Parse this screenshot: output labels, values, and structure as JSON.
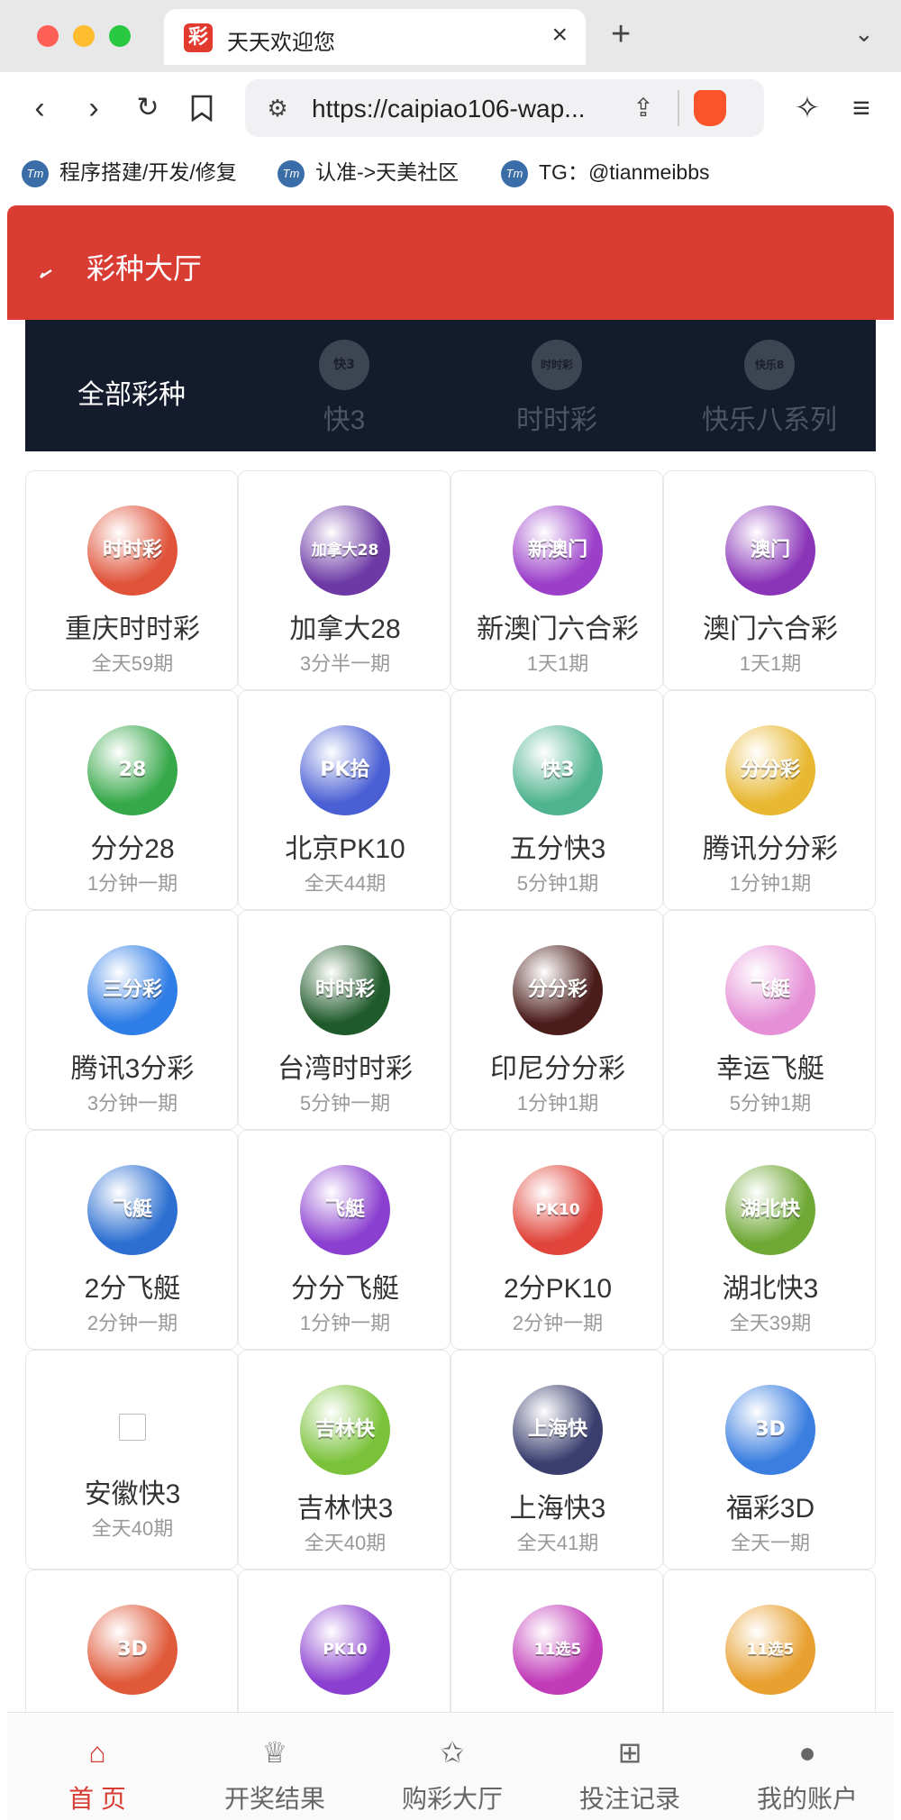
{
  "browser": {
    "tab_title": "天天欢迎您",
    "tab_favicon": "彩",
    "url": "https://caipiao106-wap...",
    "bookmarks": [
      "程序搭建/开发/修复",
      "认准->天美社区",
      "TG：@tianmeibbs"
    ],
    "bookmark_icon_text": "Tm"
  },
  "header": {
    "title": "彩种大厅"
  },
  "categories": [
    {
      "label": "全部彩种",
      "active": true
    },
    {
      "label": "快3",
      "icon_text": "快3"
    },
    {
      "label": "时时彩",
      "icon_text": "时时彩"
    },
    {
      "label": "快乐八系列",
      "icon_text": "快乐8"
    }
  ],
  "lotteries": [
    {
      "name": "重庆时时彩",
      "period": "全天59期",
      "logo": "时时彩",
      "color": "#e0533a"
    },
    {
      "name": "加拿大28",
      "period": "3分半一期",
      "logo": "加拿大28",
      "color": "#6d3aa5"
    },
    {
      "name": "新澳门六合彩",
      "period": "1天1期",
      "logo": "新澳门",
      "color": "#9b3fc9"
    },
    {
      "name": "澳门六合彩",
      "period": "1天1期",
      "logo": "澳门",
      "color": "#8a35b8"
    },
    {
      "name": "分分28",
      "period": "1分钟一期",
      "logo": "28",
      "color": "#37a84a"
    },
    {
      "name": "北京PK10",
      "period": "全天44期",
      "logo": "PK拾",
      "color": "#4a5fd4"
    },
    {
      "name": "五分快3",
      "period": "5分钟1期",
      "logo": "快3",
      "color": "#4fb38f"
    },
    {
      "name": "腾讯分分彩",
      "period": "1分钟1期",
      "logo": "分分彩",
      "color": "#e8b832"
    },
    {
      "name": "腾讯3分彩",
      "period": "3分钟一期",
      "logo": "三分彩",
      "color": "#2f7de6"
    },
    {
      "name": "台湾时时彩",
      "period": "5分钟一期",
      "logo": "时时彩",
      "color": "#1f5a2a"
    },
    {
      "name": "印尼分分彩",
      "period": "1分钟1期",
      "logo": "分分彩",
      "color": "#4a1c1a"
    },
    {
      "name": "幸运飞艇",
      "period": "5分钟1期",
      "logo": "飞艇",
      "color": "#e58fd6"
    },
    {
      "name": "2分飞艇",
      "period": "2分钟一期",
      "logo": "飞艇",
      "color": "#2c6fd1"
    },
    {
      "name": "分分飞艇",
      "period": "1分钟一期",
      "logo": "飞艇",
      "color": "#8b3fd0"
    },
    {
      "name": "2分PK10",
      "period": "2分钟一期",
      "logo": "PK10",
      "color": "#e0443a"
    },
    {
      "name": "湖北快3",
      "period": "全天39期",
      "logo": "湖北快",
      "color": "#6fa835"
    },
    {
      "name": "安徽快3",
      "period": "全天40期",
      "logo": "",
      "color": "",
      "broken": true
    },
    {
      "name": "吉林快3",
      "period": "全天40期",
      "logo": "吉林快",
      "color": "#7ac23a"
    },
    {
      "name": "上海快3",
      "period": "全天41期",
      "logo": "上海快",
      "color": "#3a3e6e"
    },
    {
      "name": "福彩3D",
      "period": "全天一期",
      "logo": "3D",
      "color": "#3a7ee0"
    },
    {
      "name": "",
      "period": "",
      "logo": "3D",
      "color": "#e05a3a"
    },
    {
      "name": "",
      "period": "",
      "logo": "PK10",
      "color": "#8b3fd0"
    },
    {
      "name": "",
      "period": "",
      "logo": "11选5",
      "color": "#c13ab8"
    },
    {
      "name": "",
      "period": "",
      "logo": "11选5",
      "color": "#e8a030"
    }
  ],
  "bottom_nav": [
    {
      "label": "首 页",
      "icon": "home-icon",
      "active": true
    },
    {
      "label": "开奖结果",
      "icon": "trophy-icon"
    },
    {
      "label": "购彩大厅",
      "icon": "star-icon"
    },
    {
      "label": "投注记录",
      "icon": "gift-icon"
    },
    {
      "label": "我的账户",
      "icon": "user-icon"
    }
  ],
  "colors": {
    "primary_red": "#d83c32",
    "tab_bg": "#141b2d"
  }
}
